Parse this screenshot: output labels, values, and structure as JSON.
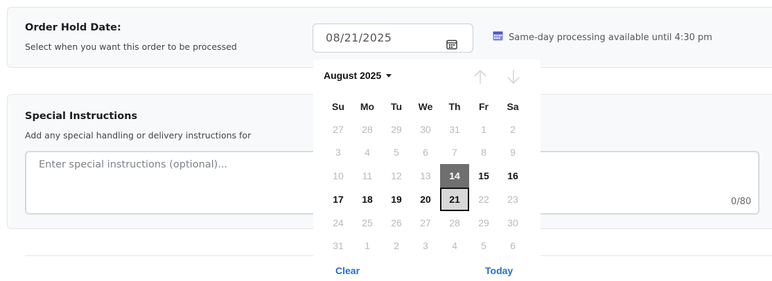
{
  "hold": {
    "title": "Order Hold Date:",
    "subtitle": "Select when you want this order to be processed",
    "date_value": "08/21/2025",
    "note": "Same-day processing available until 4:30 pm"
  },
  "instructions": {
    "title": "Special Instructions",
    "subtitle": "Add any special handling or delivery instructions for",
    "placeholder": "Enter special instructions (optional)...",
    "counter": "0/80"
  },
  "calendar": {
    "month_label": "August 2025",
    "weekdays": [
      "Su",
      "Mo",
      "Tu",
      "We",
      "Th",
      "Fr",
      "Sa"
    ],
    "weeks": [
      [
        "27",
        "28",
        "29",
        "30",
        "31",
        "1",
        "2"
      ],
      [
        "3",
        "4",
        "5",
        "6",
        "7",
        "8",
        "9"
      ],
      [
        "10",
        "11",
        "12",
        "13",
        "14",
        "15",
        "16"
      ],
      [
        "17",
        "18",
        "19",
        "20",
        "21",
        "22",
        "23"
      ],
      [
        "24",
        "25",
        "26",
        "27",
        "28",
        "29",
        "30"
      ],
      [
        "31",
        "1",
        "2",
        "3",
        "4",
        "5",
        "6"
      ]
    ],
    "today": "14",
    "selected": "21",
    "clear_label": "Clear",
    "today_label": "Today"
  },
  "colors": {
    "link": "#1f6fd1",
    "today_bg": "#6f6f6f",
    "selected_bg": "#d8d8d8"
  },
  "icons": [
    "calendar-icon",
    "calendar-note-icon",
    "caret-down-icon",
    "arrow-up-icon",
    "arrow-down-icon"
  ]
}
